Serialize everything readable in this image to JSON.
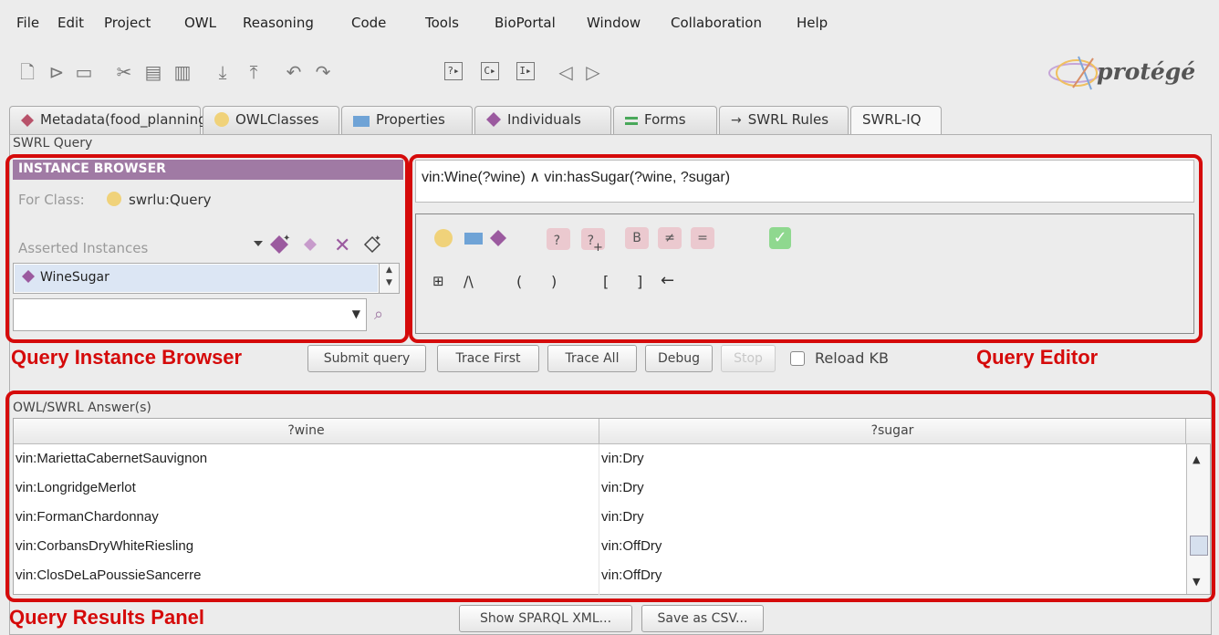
{
  "menubar": {
    "items": [
      {
        "label": "File"
      },
      {
        "label": "Edit"
      },
      {
        "label": "Project"
      },
      {
        "label": "OWL"
      },
      {
        "label": "Reasoning"
      },
      {
        "label": "Code"
      },
      {
        "label": "Tools"
      },
      {
        "label": "BioPortal"
      },
      {
        "label": "Window"
      },
      {
        "label": "Collaboration"
      },
      {
        "label": "Help"
      }
    ]
  },
  "toolbar": {
    "logo_text": "protégé"
  },
  "tabs": [
    {
      "label": "Metadata(food_planning.owl)",
      "icon": "purple-diamond-icon"
    },
    {
      "label": "OWLClasses",
      "icon": "yellow-circle-icon"
    },
    {
      "label": "Properties",
      "icon": "blue-rect-icon"
    },
    {
      "label": "Individuals",
      "icon": "purple-diamond-icon"
    },
    {
      "label": "Forms",
      "icon": "green-lines-icon"
    },
    {
      "label": "SWRL Rules",
      "icon": "arrow-right-icon"
    },
    {
      "label": "SWRL-IQ",
      "icon": ""
    }
  ],
  "swrl_query_label": "SWRL Query",
  "instance_browser": {
    "header": "INSTANCE BROWSER",
    "for_class_label": "For Class:",
    "for_class_value": "swrlu:Query",
    "asserted_label": "Asserted Instances",
    "items": [
      "WineSugar"
    ]
  },
  "query_editor": {
    "text": "vin:Wine(?wine) ∧ vin:hasSugar(?wine, ?sugar)",
    "palette": {
      "b_label": "B",
      "neq_label": "≠",
      "eq_label": "=",
      "and_label": "/\\",
      "lparen": "(",
      "rparen": ")",
      "lbracket": "[",
      "rbracket": "]",
      "arrow": "←"
    }
  },
  "actions": {
    "submit": "Submit query",
    "trace_first": "Trace First",
    "trace_all": "Trace All",
    "debug": "Debug",
    "stop": "Stop",
    "reload_kb": "Reload KB"
  },
  "annotations": {
    "instance_browser": "Query Instance Browser",
    "query_editor": "Query Editor",
    "results_panel": "Query Results Panel"
  },
  "answers": {
    "label": "OWL/SWRL Answer(s)",
    "columns": [
      "?wine",
      "?sugar"
    ],
    "rows": [
      [
        "vin:MariettaCabernetSauvignon",
        "vin:Dry"
      ],
      [
        "vin:LongridgeMerlot",
        "vin:Dry"
      ],
      [
        "vin:FormanChardonnay",
        "vin:Dry"
      ],
      [
        "vin:CorbansDryWhiteRiesling",
        "vin:OffDry"
      ],
      [
        "vin:ClosDeLaPoussieSancerre",
        "vin:OffDry"
      ]
    ]
  },
  "footer_buttons": {
    "show_sparql": "Show SPARQL XML...",
    "save_csv": "Save as CSV..."
  },
  "colors": {
    "annotation_red": "#d50a0a",
    "instance_header": "#a07aa4",
    "class_yellow": "#f0d27a",
    "property_blue": "#6fa3d6",
    "individual_purple": "#9b5a9f"
  }
}
